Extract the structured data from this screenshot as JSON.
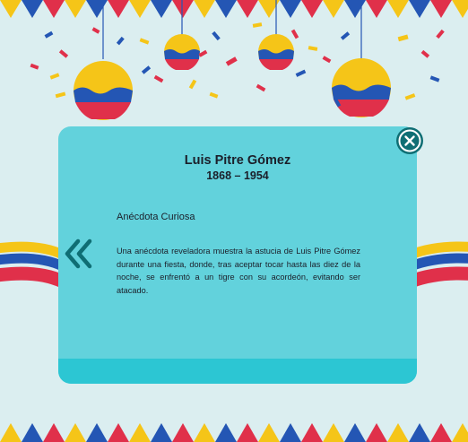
{
  "modal": {
    "title": "Luis Pitre Gómez",
    "years": "1868 – 1954",
    "subheading": "Anécdota Curiosa",
    "body": "Una anécdota reveladora muestra la astucia de Luis Pitre Gómez durante una fiesta, donde, tras aceptar tocar hasta las diez de la noche, se enfrentó a un tigre con su acordeón, evitando ser atacado."
  },
  "controls": {
    "close_icon": "close-circle-icon",
    "prev_icon": "double-chevron-left-icon"
  },
  "colors": {
    "background": "#dbeef0",
    "card": "#62d2dc",
    "card_footer": "#2cc6d3",
    "accent_dark": "#0f6e74",
    "flag_yellow": "#f5c518",
    "flag_blue": "#2456b4",
    "flag_red": "#e0304a"
  }
}
